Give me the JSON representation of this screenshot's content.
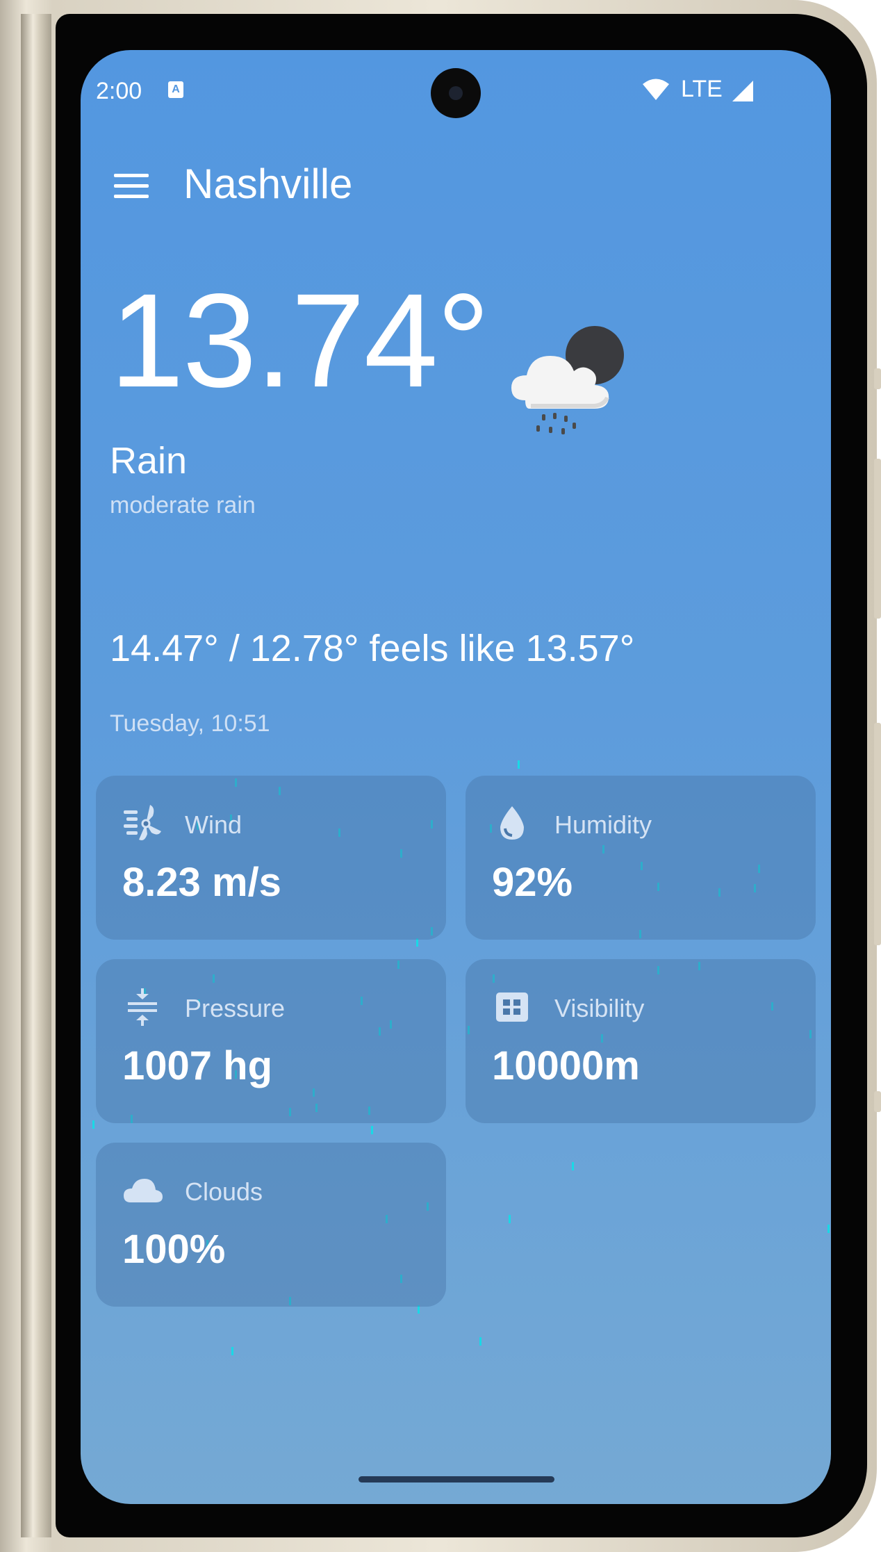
{
  "status_bar": {
    "time": "2:00",
    "notification_icon": "accessibility-icon",
    "network_label": "LTE",
    "icons": [
      "wifi-icon",
      "signal-icon"
    ]
  },
  "app_bar": {
    "menu_icon": "hamburger-menu-icon",
    "city": "Nashville"
  },
  "current": {
    "temperature": "13.74°",
    "condition": "Rain",
    "description": "moderate rain",
    "weather_icon": "cloud-moon-rain-icon",
    "minmax_feels": "14.47° / 12.78° feels like 13.57°",
    "datetime": "Tuesday, 10:51"
  },
  "details": [
    {
      "id": "wind",
      "label": "Wind",
      "value": "8.23 m/s",
      "icon": "wind-turbine-icon"
    },
    {
      "id": "humidity",
      "label": "Humidity",
      "value": "92%",
      "icon": "water-drop-icon"
    },
    {
      "id": "pressure",
      "label": "Pressure",
      "value": "1007 hg",
      "icon": "pressure-compress-icon"
    },
    {
      "id": "visibility",
      "label": "Visibility",
      "value": "10000m",
      "icon": "grid-view-icon"
    },
    {
      "id": "clouds",
      "label": "Clouds",
      "value": "100%",
      "icon": "cloud-icon"
    }
  ],
  "colors": {
    "background_top": "#5397e0",
    "background_bottom": "#75a9d4",
    "card": "#4a78aa",
    "rain_drops": "#19d9e6",
    "secondary_text": "#cfe0f5"
  }
}
